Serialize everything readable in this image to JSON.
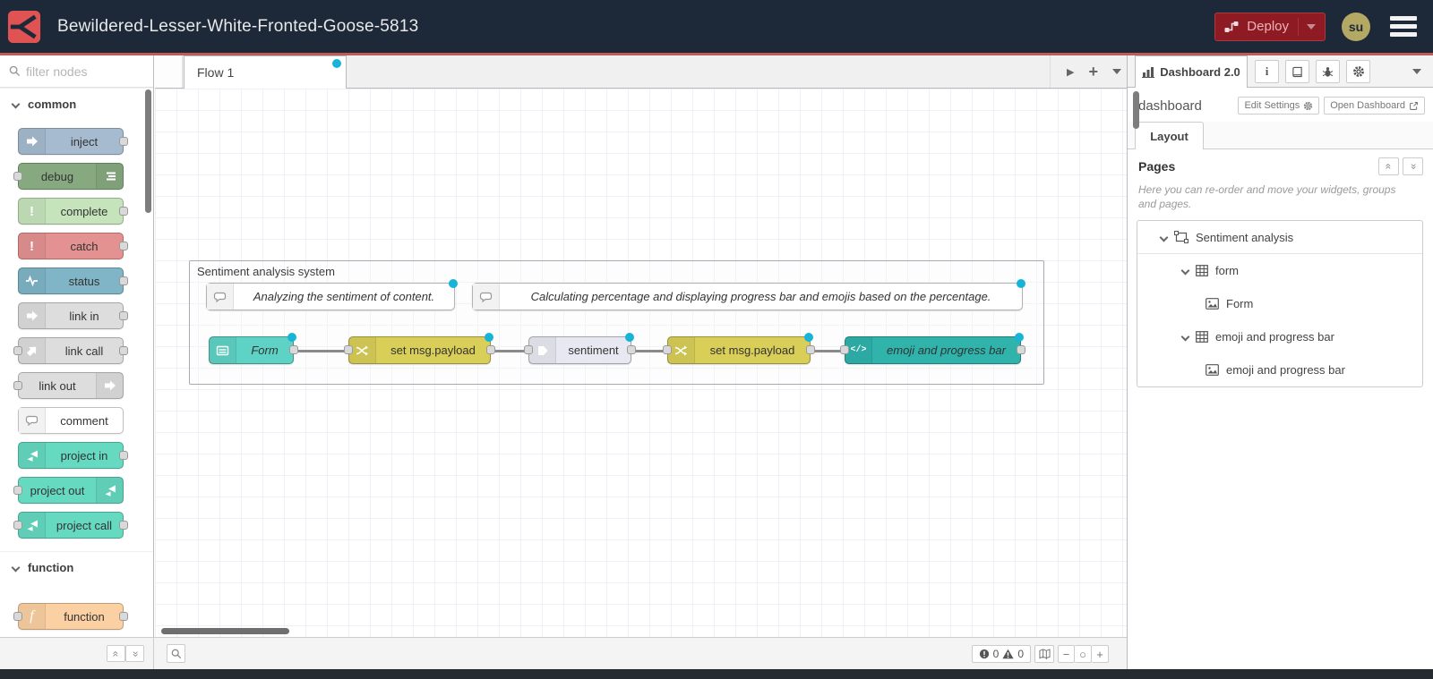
{
  "glyphs": {
    "play": "▶",
    "plus": "+",
    "minus": "−",
    "circle": "○",
    "exclaim": "!",
    "function_f": "f",
    "code": "</>",
    "info_i": "i",
    "double_chevron": "«"
  },
  "colors": {
    "header_bg": "#1d2839",
    "accent_red": "#c05a56",
    "deploy_bg": "#8e1a24",
    "modified_dot": "#18b4d8",
    "avatar_bg": "#b3a964"
  },
  "header": {
    "title": "Bewildered-Lesser-White-Fronted-Goose-5813",
    "deploy_label": "Deploy",
    "user_initials": "su"
  },
  "palette": {
    "filter_placeholder": "filter nodes",
    "categories": [
      {
        "label": "common",
        "nodes": [
          {
            "label": "inject",
            "color": "#a6bbcf",
            "icon": "arrow-right-icon"
          },
          {
            "label": "debug",
            "color": "#87a980",
            "icon": "debug-list-icon"
          },
          {
            "label": "complete",
            "color": "#c6e4bc",
            "icon": "exclamation-icon"
          },
          {
            "label": "catch",
            "color": "#e49191",
            "icon": "exclamation-icon"
          },
          {
            "label": "status",
            "color": "#7fb5c6",
            "icon": "heartbeat-icon"
          },
          {
            "label": "link in",
            "color": "#dddddd",
            "icon": "link-arrow-icon"
          },
          {
            "label": "link call",
            "color": "#dddddd",
            "icon": "link-arrow-icon"
          },
          {
            "label": "link out",
            "color": "#dddddd",
            "icon": "link-arrow-icon"
          },
          {
            "label": "comment",
            "color": "#ffffff",
            "icon": "comment-bubble-icon"
          },
          {
            "label": "project in",
            "color": "#66d9c1",
            "icon": "project-icon"
          },
          {
            "label": "project out",
            "color": "#66d9c1",
            "icon": "project-icon"
          },
          {
            "label": "project call",
            "color": "#66d9c1",
            "icon": "project-icon"
          }
        ]
      },
      {
        "label": "function",
        "nodes": [
          {
            "label": "function",
            "color": "#fbd0a2",
            "icon": "function-f-icon"
          }
        ]
      }
    ]
  },
  "workspace": {
    "tab_label": "Flow 1",
    "group_label": "Sentiment analysis system",
    "comments": [
      {
        "text": "Analyzing the sentiment of content."
      },
      {
        "text": "Calculating percentage and displaying progress bar and emojis based on the percentage."
      }
    ],
    "nodes": [
      {
        "label": "Form",
        "color": "#5fd2c6",
        "icon": "form-icon"
      },
      {
        "label": "set msg.payload",
        "color": "#d8ce58",
        "icon": "shuffle-icon"
      },
      {
        "label": "sentiment",
        "color": "#e8e8f2",
        "icon": "arrow-pentagon-icon"
      },
      {
        "label": "set msg.payload",
        "color": "#d8ce58",
        "icon": "shuffle-icon"
      },
      {
        "label": "emoji and progress bar",
        "color": "#2fb3ab",
        "icon": "code-icon"
      }
    ],
    "footer": {
      "errors": "0",
      "warnings": "0"
    }
  },
  "sidebar": {
    "tab_label": "Dashboard 2.0",
    "dashboard_name": "dashboard",
    "edit_settings_label": "Edit Settings",
    "open_dashboard_label": "Open Dashboard",
    "layout_tab_label": "Layout",
    "pages": {
      "title": "Pages",
      "description": "Here you can re-order and move your widgets, groups and pages.",
      "page_label": "Sentiment analysis",
      "groups": [
        {
          "label": "form",
          "widgets": [
            {
              "label": "Form"
            }
          ]
        },
        {
          "label": "emoji and progress bar",
          "widgets": [
            {
              "label": "emoji and progress bar"
            }
          ]
        }
      ]
    }
  }
}
